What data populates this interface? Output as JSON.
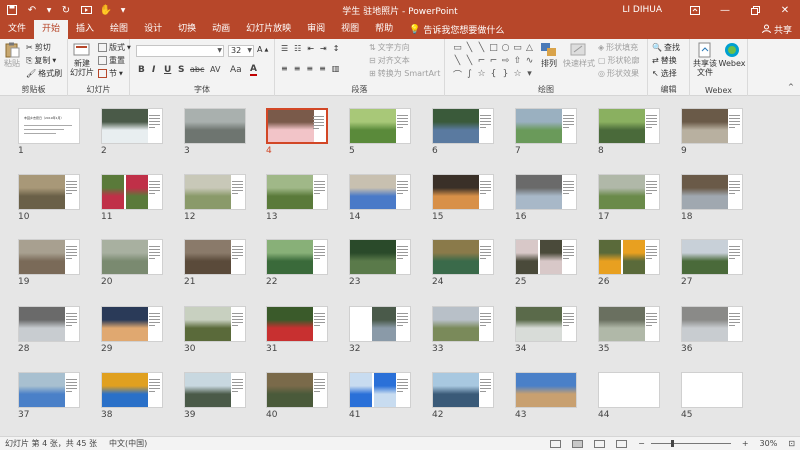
{
  "app": {
    "title": "学生 驻地照片 - PowerPoint",
    "user": "LI DIHUA",
    "share_label": "共享",
    "tell_me": "告诉我您想要做什么"
  },
  "tabs": [
    "文件",
    "开始",
    "插入",
    "绘图",
    "设计",
    "切换",
    "动画",
    "幻灯片放映",
    "审阅",
    "视图",
    "帮助"
  ],
  "active_tab": "开始",
  "ribbon": {
    "clipboard": {
      "label": "剪贴板",
      "paste": "粘贴",
      "cut": "剪切",
      "copy": "复制",
      "format_painter": "格式刷"
    },
    "slides": {
      "label": "幻灯片",
      "new_slide": "新建\n幻灯片",
      "layout": "版式",
      "reset": "重置",
      "section": "节"
    },
    "font": {
      "label": "字体",
      "font_name": "",
      "font_size": "32",
      "bold": "B",
      "italic": "I",
      "underline": "U",
      "strike": "S",
      "shadow": "abc",
      "spacing": "AV",
      "case": "Aa",
      "color": "A"
    },
    "paragraph": {
      "label": "段落",
      "text_direction": "文字方向",
      "align_text": "对齐文本",
      "smartart": "转换为 SmartArt"
    },
    "drawing": {
      "label": "绘图",
      "arrange": "排列",
      "quick_styles": "快速样式",
      "fill": "形状填充",
      "outline": "形状轮廓",
      "effects": "形状效果"
    },
    "editing": {
      "label": "编辑",
      "find": "查找",
      "replace": "替换",
      "select": "选择"
    },
    "webex": {
      "label": "Webex",
      "share_file": "共享该\n文件",
      "webex": "Webex"
    }
  },
  "slides": {
    "selected": 4,
    "title_slide_text": "丰园乡志愿日（2019年1月）",
    "items": [
      {
        "n": 1
      },
      {
        "n": 2
      },
      {
        "n": 3
      },
      {
        "n": 4
      },
      {
        "n": 5
      },
      {
        "n": 6
      },
      {
        "n": 7
      },
      {
        "n": 8
      },
      {
        "n": 9
      },
      {
        "n": 10
      },
      {
        "n": 11
      },
      {
        "n": 12
      },
      {
        "n": 13
      },
      {
        "n": 14
      },
      {
        "n": 15
      },
      {
        "n": 16
      },
      {
        "n": 17
      },
      {
        "n": 18
      },
      {
        "n": 19
      },
      {
        "n": 20
      },
      {
        "n": 21
      },
      {
        "n": 22
      },
      {
        "n": 23
      },
      {
        "n": 24
      },
      {
        "n": 25
      },
      {
        "n": 26
      },
      {
        "n": 27
      },
      {
        "n": 28
      },
      {
        "n": 29
      },
      {
        "n": 30
      },
      {
        "n": 31
      },
      {
        "n": 32
      },
      {
        "n": 33
      },
      {
        "n": 34
      },
      {
        "n": 35
      },
      {
        "n": 36
      },
      {
        "n": 37
      },
      {
        "n": 38
      },
      {
        "n": 39
      },
      {
        "n": 40
      },
      {
        "n": 41
      },
      {
        "n": 42
      },
      {
        "n": 43
      },
      {
        "n": 44
      },
      {
        "n": 45
      }
    ]
  },
  "status": {
    "slide_info": "幻灯片 第 4 张，共 45 张",
    "language": "中文(中国)",
    "zoom": "30%",
    "zoom_minus": "−",
    "zoom_plus": "+"
  },
  "colors": {
    "accent": "#b7472a",
    "selected_border": "#d24726"
  }
}
